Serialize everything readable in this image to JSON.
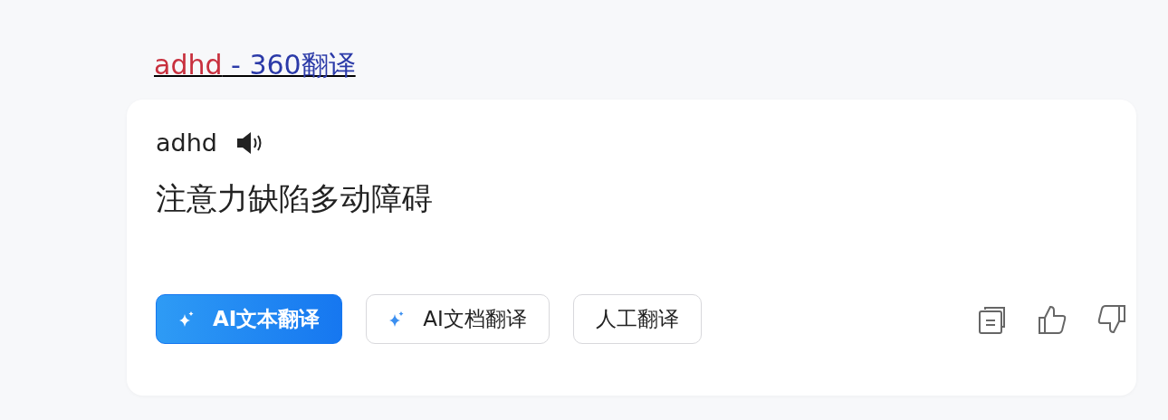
{
  "title_link": {
    "query": "adhd",
    "suffix": " - 360翻译"
  },
  "card": {
    "source_word": "adhd",
    "translation": "注意力缺陷多动障碍",
    "buttons": [
      {
        "label": "AI文本翻译",
        "kind": "ai",
        "selected": true
      },
      {
        "label": "AI文档翻译",
        "kind": "ai",
        "selected": false
      },
      {
        "label": "人工翻译",
        "kind": "plain",
        "selected": false
      }
    ]
  }
}
